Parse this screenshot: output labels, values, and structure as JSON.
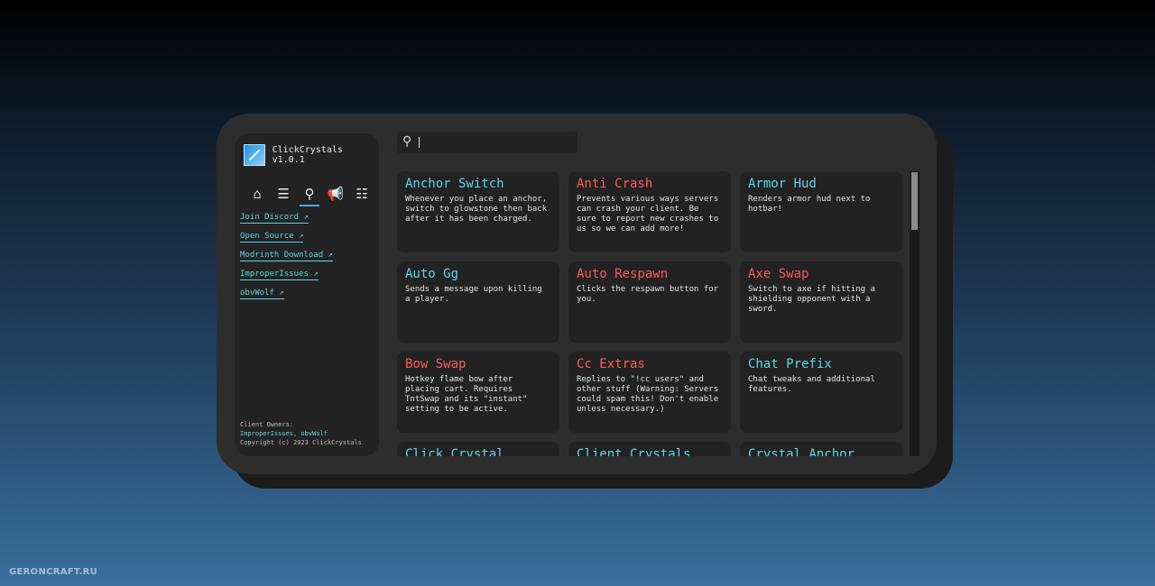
{
  "sidebar": {
    "brand": "ClickCrystals v1.0.1",
    "nav_icons": [
      {
        "name": "home-icon",
        "glyph": "⌂"
      },
      {
        "name": "modules-icon",
        "glyph": "☰"
      },
      {
        "name": "search-icon",
        "glyph": "⚲"
      },
      {
        "name": "announcement-icon",
        "glyph": "📢"
      },
      {
        "name": "settings-icon",
        "glyph": "☷"
      }
    ],
    "links": [
      "Join Discord ↗",
      "Open Source ↗",
      "Modrinth Download ↗",
      "ImproperIssues ↗",
      "obvWolf ↗"
    ],
    "credits": {
      "line1": "Client Owners:",
      "line2": "ImproperIssues, obvWolf",
      "line3": "Copyright (c) 2023 ClickCrystals"
    }
  },
  "search": {
    "icon": "⚲",
    "value": "",
    "placeholder": ""
  },
  "modules": [
    {
      "title": "Anchor Switch",
      "color": "cyan",
      "desc": "Whenever you place an anchor, switch to glowstone then back after it has been charged."
    },
    {
      "title": "Anti Crash",
      "color": "red",
      "desc": "Prevents various ways servers can crash your client. Be sure to report new crashes to us so we can add more!"
    },
    {
      "title": "Armor Hud",
      "color": "cyan",
      "desc": "Renders armor hud next to hotbar!"
    },
    {
      "title": "Auto Gg",
      "color": "cyan",
      "desc": "Sends a message upon killing a player."
    },
    {
      "title": "Auto Respawn",
      "color": "red",
      "desc": "Clicks the respawn button for you."
    },
    {
      "title": "Axe Swap",
      "color": "red",
      "desc": "Switch to axe if hitting a shielding opponent with a sword."
    },
    {
      "title": "Bow Swap",
      "color": "red",
      "desc": "Hotkey flame bow after placing cart. Requires TntSwap and its \"instant\" setting to be active."
    },
    {
      "title": "Cc Extras",
      "color": "red",
      "desc": "Replies to \"!cc users\" and other stuff (Warning: Servers could spam this! Don't enable unless necessary.)"
    },
    {
      "title": "Chat Prefix",
      "color": "cyan",
      "desc": "Chat tweaks and additional features."
    },
    {
      "title": "Click Crystal",
      "color": "cyan",
      "desc": ""
    },
    {
      "title": "Client Crystals",
      "color": "cyan",
      "desc": ""
    },
    {
      "title": "Crystal Anchor",
      "color": "cyan",
      "desc": ""
    }
  ],
  "watermark": "GERONCRAFT.RU"
}
